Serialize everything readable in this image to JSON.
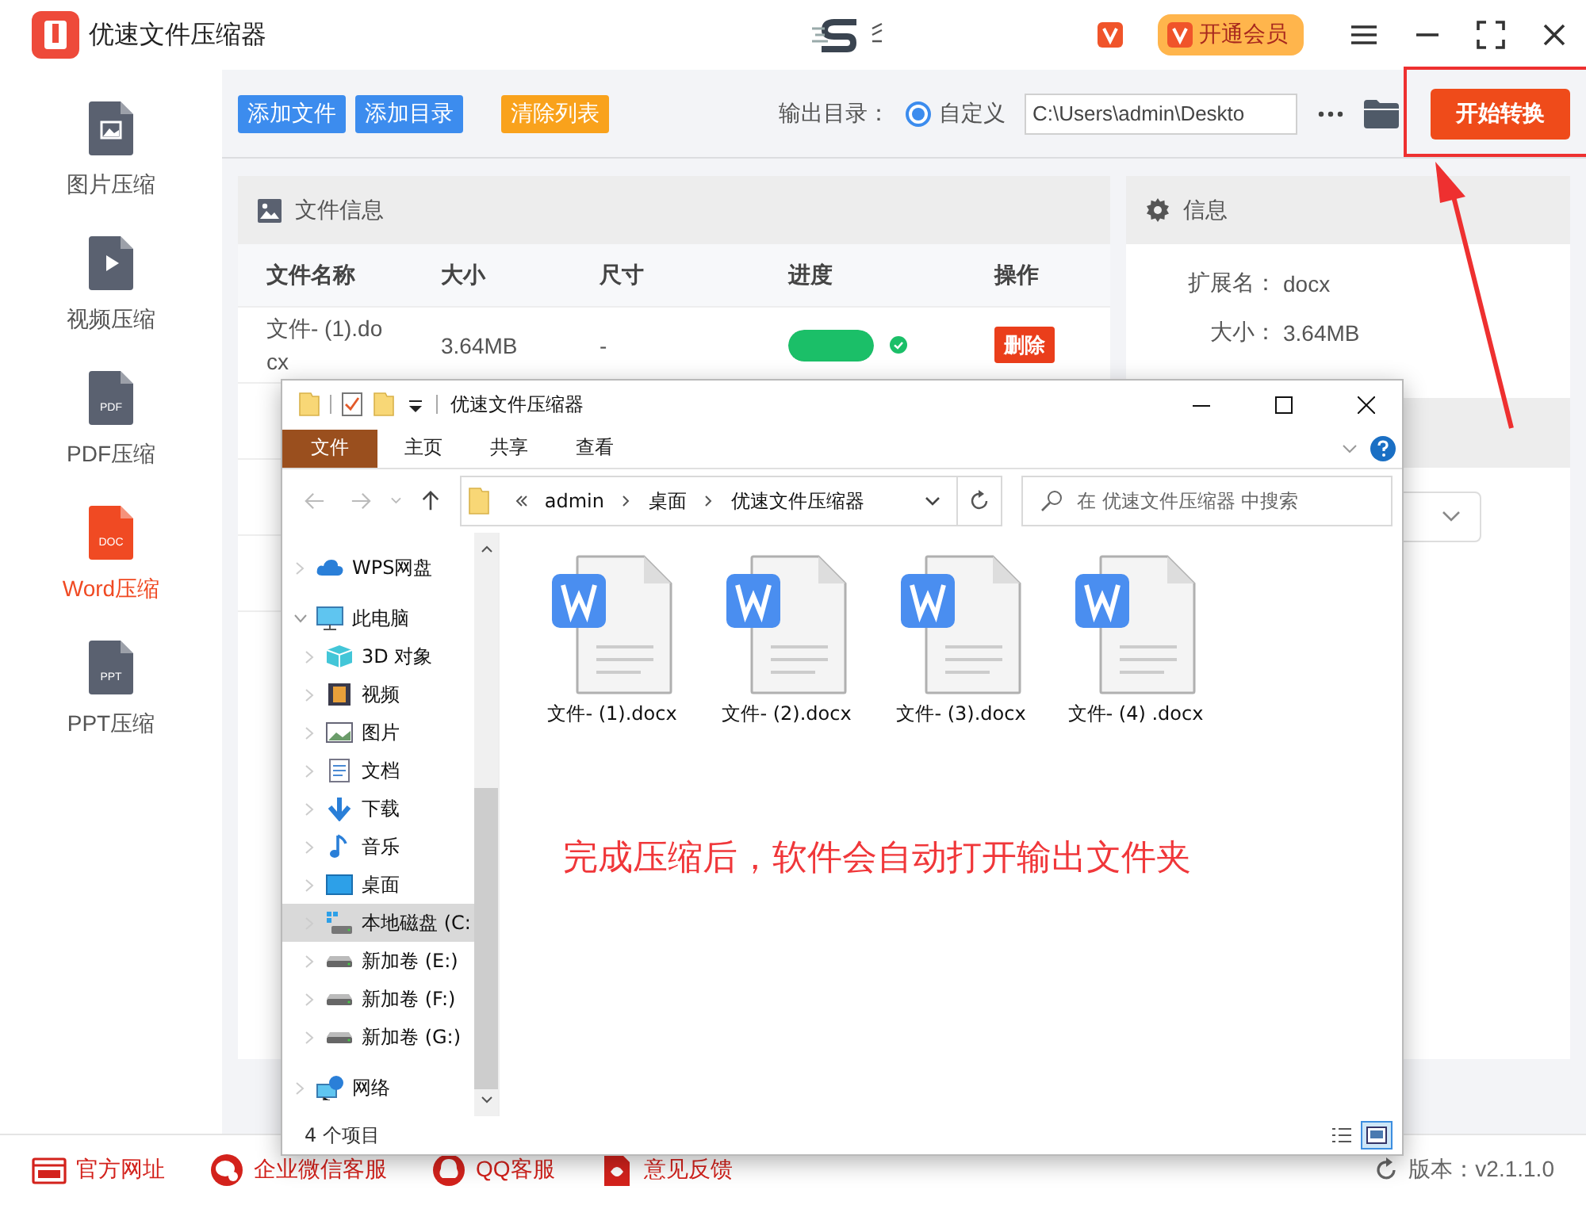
{
  "app": {
    "title": "优速文件压缩器",
    "vip_button": "开通会员"
  },
  "sidebar": {
    "items": [
      {
        "label": "图片压缩",
        "kind": "image",
        "selected": false
      },
      {
        "label": "视频压缩",
        "kind": "video",
        "selected": false
      },
      {
        "label": "PDF压缩",
        "kind": "file",
        "icon_text": "PDF",
        "selected": false
      },
      {
        "label": "Word压缩",
        "kind": "file",
        "icon_text": "DOC",
        "selected": true
      },
      {
        "label": "PPT压缩",
        "kind": "file",
        "icon_text": "PPT",
        "selected": false
      }
    ]
  },
  "toolbar": {
    "buttons": [
      {
        "label": "添加文件",
        "kind": "blue"
      },
      {
        "label": "添加目录",
        "kind": "blue"
      },
      {
        "label": "清除列表",
        "kind": "orange"
      }
    ],
    "output_label": "输出目录：",
    "radio": {
      "label": "自定义",
      "selected": true
    },
    "path": "C:\\Users\\admin\\Deskto",
    "start_button": "开始转换",
    "start_highlighted": true
  },
  "file_panel": {
    "title": "文件信息",
    "columns": [
      "文件名称",
      "大小",
      "尺寸",
      "进度",
      "操作"
    ],
    "rows": [
      {
        "name_lines": [
          "文件- (1).do",
          "cx"
        ],
        "size": "3.64MB",
        "dimensions": "-",
        "level": 1,
        "done": true,
        "action": "删除"
      }
    ]
  },
  "info_panel": {
    "title": "信息",
    "fields": [
      {
        "label": "扩展名：",
        "value": "docx"
      },
      {
        "label": "大小：",
        "value": "3.64MB"
      }
    ]
  },
  "explorer": {
    "title": "优速文件压缩器",
    "ribbon_tabs": [
      {
        "label": "文件",
        "selected": true
      },
      {
        "label": "主页",
        "selected": false
      },
      {
        "label": "共享",
        "selected": false
      },
      {
        "label": "查看",
        "selected": false
      }
    ],
    "breadcrumbs": [
      "admin",
      "桌面",
      "优速文件压缩器"
    ],
    "search": {
      "placeholder": "在 优速文件压缩器 中搜索"
    },
    "tree": [
      {
        "label": "WPS网盘",
        "kind": "cloud",
        "expanded": false,
        "selected": false
      },
      {
        "label": "此电脑",
        "kind": "pc",
        "expanded": true,
        "selected": false,
        "children": [
          {
            "label": "3D 对象",
            "kind": "cube",
            "selected": false
          },
          {
            "label": "视频",
            "kind": "film",
            "selected": false
          },
          {
            "label": "图片",
            "kind": "picture",
            "selected": false
          },
          {
            "label": "文档",
            "kind": "doc",
            "selected": false
          },
          {
            "label": "下载",
            "kind": "download",
            "selected": false
          },
          {
            "label": "音乐",
            "kind": "music",
            "selected": false
          },
          {
            "label": "桌面",
            "kind": "desktop",
            "selected": false
          },
          {
            "label": "本地磁盘 (C:",
            "kind": "windisk",
            "selected": true
          },
          {
            "label": "新加卷 (E:)",
            "kind": "disk",
            "selected": false
          },
          {
            "label": "新加卷 (F:)",
            "kind": "disk",
            "selected": false
          },
          {
            "label": "新加卷 (G:)",
            "kind": "disk",
            "selected": false
          }
        ]
      },
      {
        "label": "网络",
        "kind": "network",
        "expanded": false,
        "selected": false
      }
    ],
    "files": [
      {
        "name": "文件- (1).docx"
      },
      {
        "name": "文件- (2).docx"
      },
      {
        "name": "文件- (3).docx"
      },
      {
        "name": "文件- (4) .docx"
      }
    ],
    "note": "完成压缩后，软件会自动打开输出文件夹",
    "status": "4 个项目",
    "views": [
      {
        "kind": "details",
        "selected": false
      },
      {
        "kind": "large",
        "selected": true
      }
    ]
  },
  "footer": {
    "links": [
      {
        "label": "官方网址",
        "kind": "web"
      },
      {
        "label": "企业微信客服",
        "kind": "wechat"
      },
      {
        "label": "QQ客服",
        "kind": "qq"
      },
      {
        "label": "意见反馈",
        "kind": "feedback"
      }
    ],
    "version": "版本：v2.1.1.0"
  }
}
